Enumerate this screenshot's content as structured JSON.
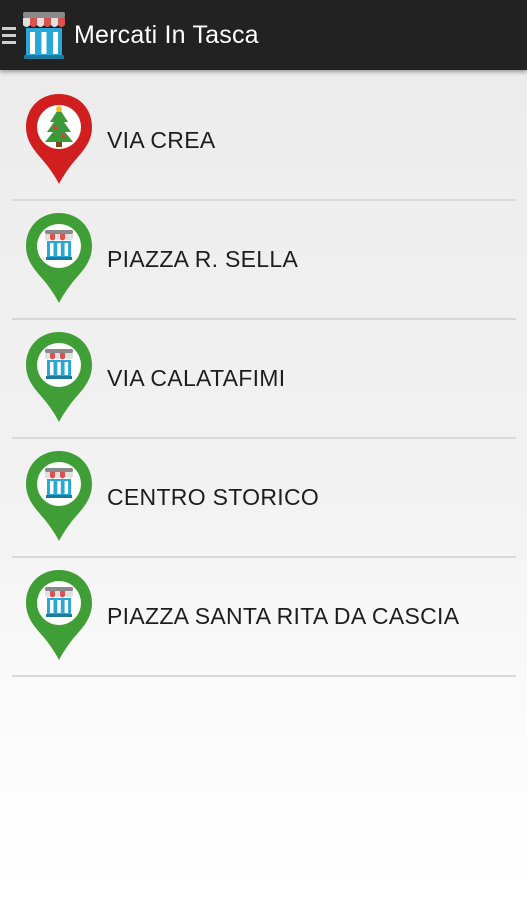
{
  "app": {
    "title": "Mercati In Tasca",
    "logo_icon": "market-stall-icon"
  },
  "colors": {
    "action_bar": "#222222",
    "pin_red": "#d11f1f",
    "pin_green": "#3f9e35",
    "awning_red": "#d9534f",
    "stall_blue": "#29a8d8"
  },
  "markets": [
    {
      "label": "VIA CREA",
      "pin_color": "red",
      "pin_icon": "christmas-tree-icon"
    },
    {
      "label": "PIAZZA R. SELLA",
      "pin_color": "green",
      "pin_icon": "market-stall-icon"
    },
    {
      "label": "VIA CALATAFIMI",
      "pin_color": "green",
      "pin_icon": "market-stall-icon"
    },
    {
      "label": "CENTRO STORICO",
      "pin_color": "green",
      "pin_icon": "market-stall-icon"
    },
    {
      "label": "PIAZZA SANTA RITA DA CASCIA",
      "pin_color": "green",
      "pin_icon": "market-stall-icon"
    }
  ]
}
